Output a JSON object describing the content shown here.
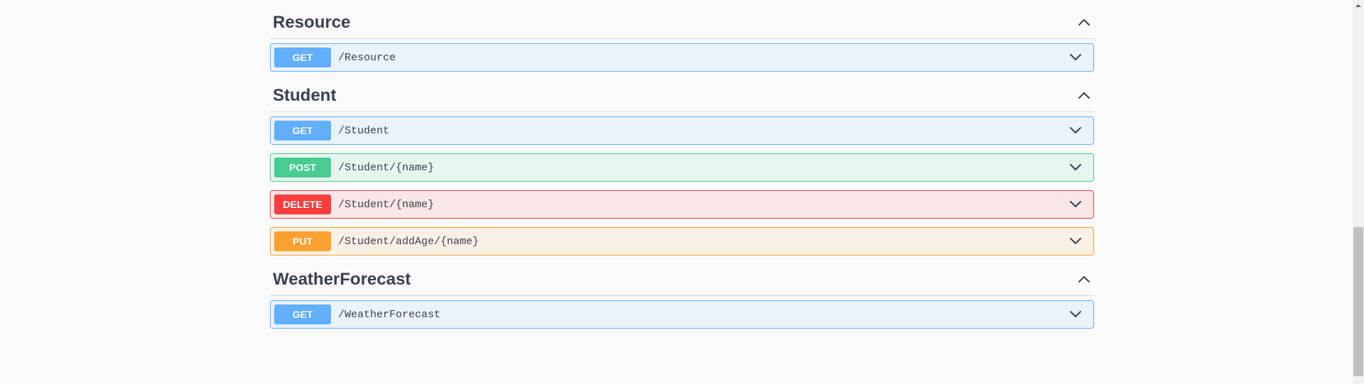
{
  "methods": {
    "get": "GET",
    "post": "POST",
    "delete": "DELETE",
    "put": "PUT"
  },
  "tags": [
    {
      "name": "Resource",
      "expanded": true,
      "ops": [
        {
          "method": "get",
          "path": "/Resource"
        }
      ]
    },
    {
      "name": "Student",
      "expanded": true,
      "ops": [
        {
          "method": "get",
          "path": "/Student"
        },
        {
          "method": "post",
          "path": "/Student/{name}"
        },
        {
          "method": "delete",
          "path": "/Student/{name}"
        },
        {
          "method": "put",
          "path": "/Student/addAge/{name}"
        }
      ]
    },
    {
      "name": "WeatherForecast",
      "expanded": true,
      "ops": [
        {
          "method": "get",
          "path": "/WeatherForecast"
        }
      ]
    }
  ],
  "scrollbar": {
    "thumbTop": 320,
    "thumbHeight": 210
  }
}
